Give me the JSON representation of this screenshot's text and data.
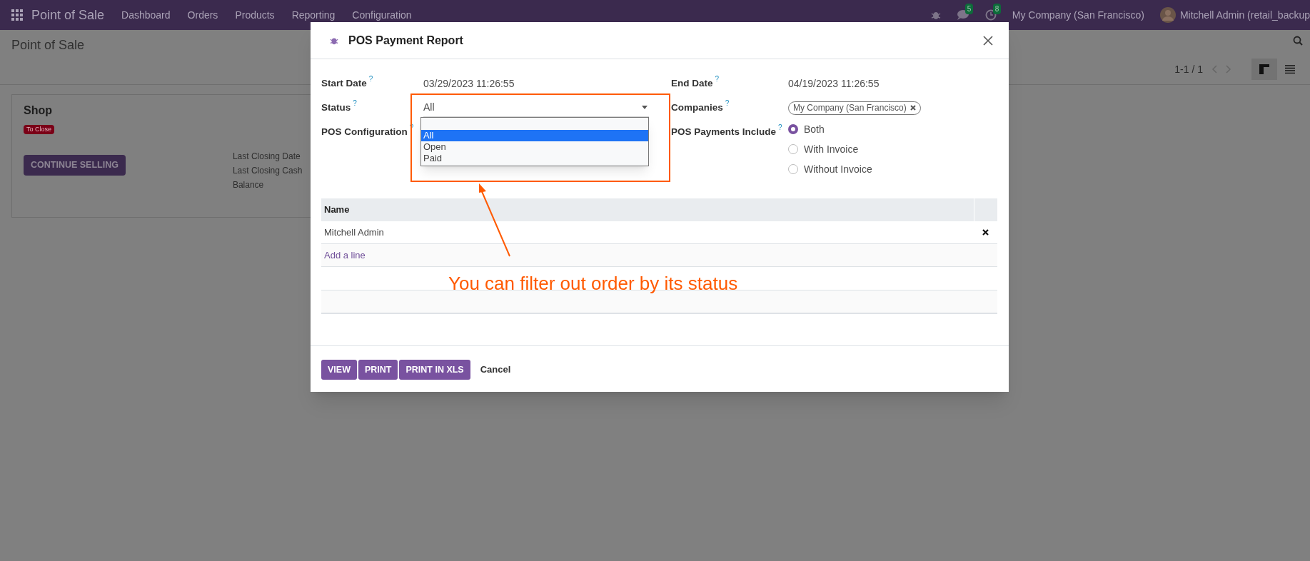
{
  "navbar": {
    "app": "Point of Sale",
    "menus": [
      "Dashboard",
      "Orders",
      "Products",
      "Reporting",
      "Configuration"
    ],
    "chat_count": "5",
    "activity_count": "8",
    "company": "My Company (San Francisco)",
    "user": "Mitchell Admin (retail_backup"
  },
  "control_panel": {
    "breadcrumb": "Point of Sale",
    "pager": "1-1 / 1",
    "views": [
      {
        "kind": "kanban",
        "selected": true
      },
      {
        "kind": "list",
        "selected": false
      }
    ]
  },
  "card": {
    "title": "Shop",
    "badge": "To Close",
    "button": "CONTINUE SELLING",
    "stats": [
      "Last Closing Date",
      "Last Closing Cash",
      "Balance"
    ]
  },
  "dialog": {
    "title": "POS Payment Report",
    "left_fields": [
      {
        "label": "Start Date",
        "help": "?",
        "kind": "text",
        "value": "03/29/2023 11:26:55"
      },
      {
        "label": "Status",
        "help": "?",
        "kind": "select",
        "value": "All",
        "options": [
          {
            "label": "All",
            "selected": true
          },
          {
            "label": "Open",
            "selected": false
          },
          {
            "label": "Paid",
            "selected": false
          }
        ]
      },
      {
        "label": "POS Configuration",
        "help": "?",
        "kind": "empty"
      }
    ],
    "right_fields": [
      {
        "label": "End Date",
        "help": "?",
        "kind": "text",
        "value": "04/19/2023 11:26:55"
      },
      {
        "label": "Companies",
        "help": "?",
        "kind": "tags",
        "tags": [
          "My Company (San Francisco)"
        ]
      },
      {
        "label": "POS Payments Include",
        "help": "?",
        "kind": "radio",
        "options": [
          {
            "label": "Both",
            "selected": true
          },
          {
            "label": "With Invoice",
            "selected": false
          },
          {
            "label": "Without Invoice",
            "selected": false
          }
        ]
      }
    ],
    "table": {
      "columns": [
        "Name"
      ],
      "rows": [
        "Mitchell Admin"
      ],
      "add_line": "Add a line"
    },
    "buttons": [
      {
        "label": "VIEW",
        "kind": "primary"
      },
      {
        "label": "PRINT",
        "kind": "primary"
      },
      {
        "label": "PRINT IN XLS",
        "kind": "primary"
      },
      {
        "label": "Cancel",
        "kind": "link"
      }
    ]
  },
  "annotation": {
    "text": "You can filter out order by its status"
  }
}
